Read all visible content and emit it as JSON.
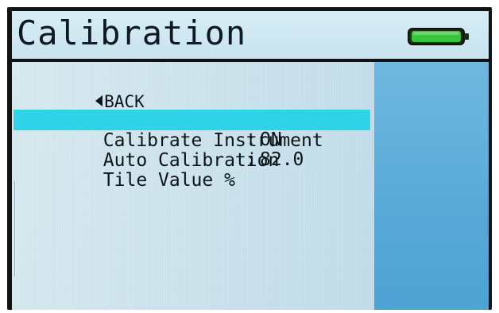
{
  "header": {
    "title": "Calibration",
    "battery_icon": "battery-full-icon",
    "battery_color": "#35c23a"
  },
  "menu": {
    "back_label": "BACK",
    "back_icon": "left-triangle-icon",
    "items": [
      {
        "label": "Calibrate Instrument",
        "separator": "",
        "value": "",
        "selected": true
      },
      {
        "label": "Auto Calibration",
        "separator": ":",
        "value": "ON",
        "selected": false
      },
      {
        "label": "Tile Value %",
        "separator": ":",
        "value": "82.0",
        "selected": false
      }
    ]
  },
  "colors": {
    "highlight": "#2fd3e6",
    "screen_background": "#c7e0ec",
    "side_panel": "#58a9d7",
    "text": "#0c1418"
  }
}
